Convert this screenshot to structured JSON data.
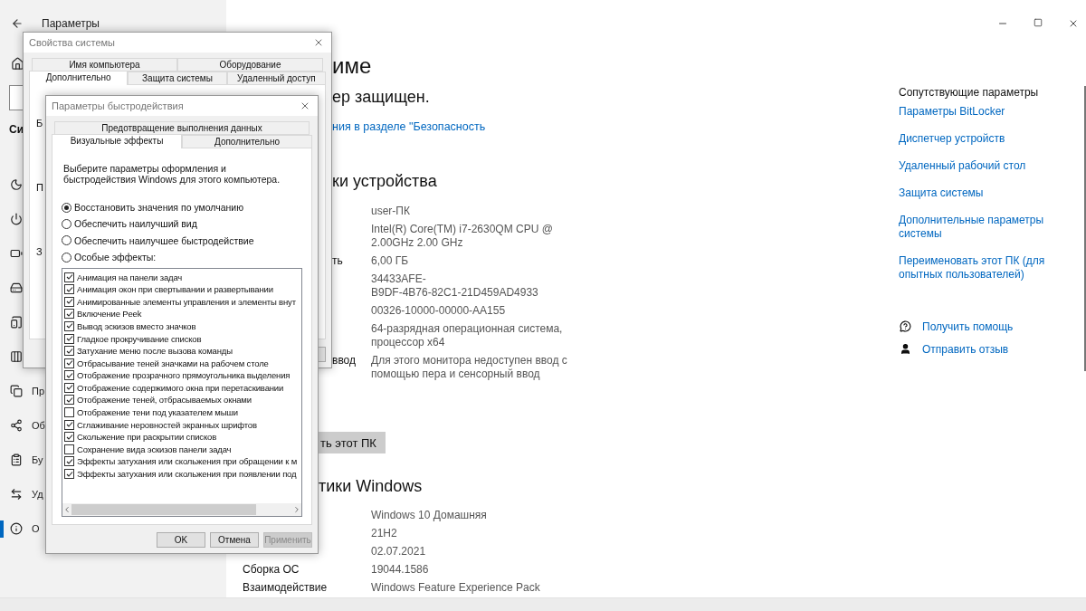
{
  "settings_window": {
    "title": "Параметры"
  },
  "sidebar": {
    "section": "Си",
    "items": [
      {
        "selected": false
      },
      {
        "selected": false
      },
      {
        "selected": false
      },
      {
        "selected": false
      },
      {
        "selected": false
      },
      {
        "selected": false
      },
      {
        "label": "Пр",
        "selected": false
      },
      {
        "label": "Об",
        "selected": false
      },
      {
        "label": "Бу",
        "selected": false
      },
      {
        "label": "Уд",
        "selected": false
      },
      {
        "label": "О",
        "selected": true
      }
    ]
  },
  "main": {
    "heading": "име",
    "security_status": "ер защищен.",
    "security_link": "ния в разделе \"Безопасность",
    "device_heading": "ки устройства",
    "device_specs": [
      {
        "value": "user-ПК"
      },
      {
        "value": "Intel(R) Core(TM) i7-2630QM CPU @\n2.00GHz   2.00 GHz"
      },
      {
        "label": "ть",
        "value": "6,00 ГБ"
      },
      {
        "value": "34433AFE-\nB9DF-4B76-82C1-21D459AD4933"
      },
      {
        "value": "00326-10000-00000-AA155"
      },
      {
        "value": "64-разрядная операционная система,\nпроцессор x64"
      },
      {
        "label": "ввод",
        "value": "Для этого монитора недоступен ввод с\nпомощью пера и сенсорный ввод"
      }
    ],
    "rename_button": "ть этот ПК",
    "windows_heading": "тики Windows",
    "windows_specs": [
      {
        "value": "Windows 10 Домашняя"
      },
      {
        "value": "21H2"
      },
      {
        "value": "02.07.2021"
      },
      {
        "label": "Сборка ОС",
        "value": "19044.1586"
      },
      {
        "label": "Взаимодействие",
        "value": "Windows Feature Experience Pack"
      }
    ]
  },
  "related": {
    "title": "Сопутствующие параметры",
    "links": [
      "Параметры BitLocker",
      "Диспетчер устройств",
      "Удаленный рабочий стол",
      "Защита системы",
      "Дополнительные параметры системы",
      "Переименовать этот ПК (для опытных пользователей)"
    ],
    "help_links": [
      "Получить помощь",
      "Отправить отзыв"
    ]
  },
  "system_properties": {
    "title": "Свойства системы",
    "tab_rows": [
      [
        {
          "label": "Имя компьютера",
          "selected": false
        },
        {
          "label": "Оборудование",
          "selected": false
        }
      ],
      [
        {
          "label": "Дополнительно",
          "selected": true
        },
        {
          "label": "Защита системы",
          "selected": false
        },
        {
          "label": "Удаленный доступ",
          "selected": false
        }
      ]
    ],
    "group_labels": [
      "Б",
      "П",
      "З"
    ]
  },
  "performance_options": {
    "title": "Параметры быстродействия",
    "tab_rows": [
      [
        {
          "label": "Предотвращение выполнения данных",
          "selected": false
        }
      ],
      [
        {
          "label": "Визуальные эффекты",
          "selected": true
        },
        {
          "label": "Дополнительно",
          "selected": false
        }
      ]
    ],
    "description": "Выберите параметры оформления и быстродействия Windows для этого компьютера.",
    "presets": [
      {
        "label": "Восстановить значения по умолчанию",
        "selected": true
      },
      {
        "label": "Обеспечить наилучший вид",
        "selected": false
      },
      {
        "label": "Обеспечить наилучшее быстродействие",
        "selected": false
      },
      {
        "label": "Особые эффекты:",
        "selected": false
      }
    ],
    "effects": [
      {
        "label": "Анимация на панели задач",
        "checked": true
      },
      {
        "label": "Анимация окон при свертывании и развертывании",
        "checked": true
      },
      {
        "label": "Анимированные элементы управления и элементы внут",
        "checked": true
      },
      {
        "label": "Включение Peek",
        "checked": true
      },
      {
        "label": "Вывод эскизов вместо значков",
        "checked": true
      },
      {
        "label": "Гладкое прокручивание списков",
        "checked": true
      },
      {
        "label": "Затухание меню после вызова команды",
        "checked": true
      },
      {
        "label": "Отбрасывание теней значками на рабочем столе",
        "checked": true
      },
      {
        "label": "Отображение прозрачного прямоугольника выделения",
        "checked": true
      },
      {
        "label": "Отображение содержимого окна при перетаскивании",
        "checked": true
      },
      {
        "label": "Отображение теней, отбрасываемых окнами",
        "checked": true
      },
      {
        "label": "Отображение тени под указателем мыши",
        "checked": false
      },
      {
        "label": "Сглаживание неровностей экранных шрифтов",
        "checked": true
      },
      {
        "label": "Скольжение при раскрытии списков",
        "checked": true
      },
      {
        "label": "Сохранение вида эскизов панели задач",
        "checked": false
      },
      {
        "label": "Эффекты затухания или скольжения при обращении к м",
        "checked": true
      },
      {
        "label": "Эффекты затухания или скольжения при появлении под",
        "checked": true
      }
    ],
    "buttons": [
      {
        "label": "OK",
        "disabled": false
      },
      {
        "label": "Отмена",
        "disabled": false
      },
      {
        "label": "Применить",
        "disabled": true
      }
    ]
  }
}
